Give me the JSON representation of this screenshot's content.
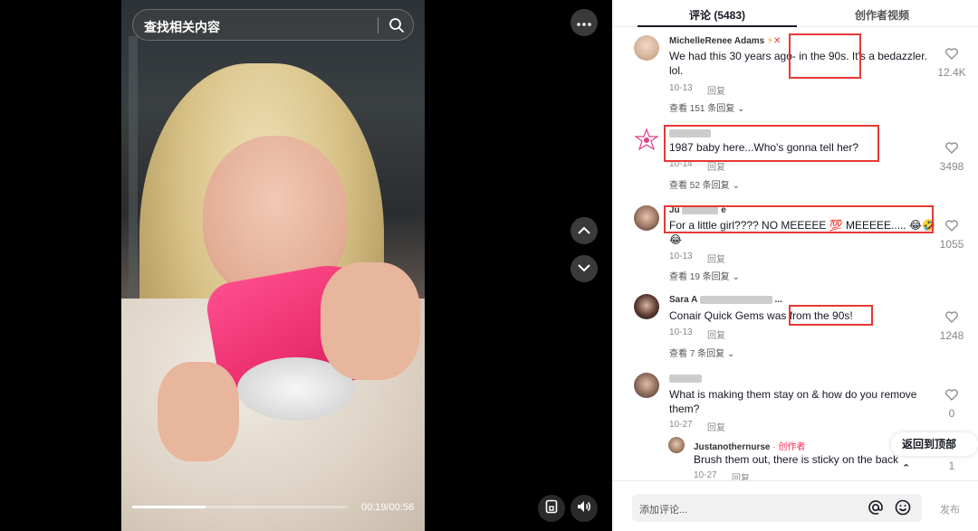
{
  "search": {
    "placeholder": "查找相关内容"
  },
  "player": {
    "time": "00:19/00:56",
    "progress_fraction": 0.34,
    "icons": [
      "more-icon",
      "search-icon",
      "chevron-up-icon",
      "chevron-down-icon",
      "save-icon",
      "volume-icon"
    ]
  },
  "tabs": {
    "comments": "评论 (5483)",
    "creator_videos": "创作者视频"
  },
  "comments": [
    {
      "author": "MichelleRenee Adams",
      "text": "We had this 30 years ago- in the 90s. It's a bedazzler. lol.",
      "date": "10-13",
      "reply": "回复",
      "more_replies": "查看 151 条回复",
      "likes": "12.4K"
    },
    {
      "author": "",
      "text": "1987 baby here...Who's gonna tell her?",
      "date": "10-14",
      "reply": "回复",
      "more_replies": "查看 52 条回复",
      "likes": "3498"
    },
    {
      "author": "Ju",
      "text": "For a little girl???? NO MEEEEE 💯 MEEEEE..... 😂🤣😂",
      "date": "10-13",
      "reply": "回复",
      "more_replies": "查看 19 条回复",
      "likes": "1055"
    },
    {
      "author": "Sara A",
      "text": "Conair Quick Gems was from the 90s!",
      "date": "10-13",
      "reply": "回复",
      "more_replies": "查看 7 条回复",
      "likes": "1248"
    },
    {
      "author": "",
      "text": "What is making them stay on & how do you remove them?",
      "date": "10-27",
      "reply": "回复",
      "likes": "0",
      "sub_reply": {
        "author": "Justanothernurse",
        "badge": "· 创作者",
        "text": "Brush them out, there is sticky on the back",
        "date": "10-27",
        "reply": "回复",
        "likes": "1"
      }
    }
  ],
  "back_to_top": "返回到顶部",
  "composer": {
    "placeholder": "添加评论...",
    "post": "发布"
  }
}
